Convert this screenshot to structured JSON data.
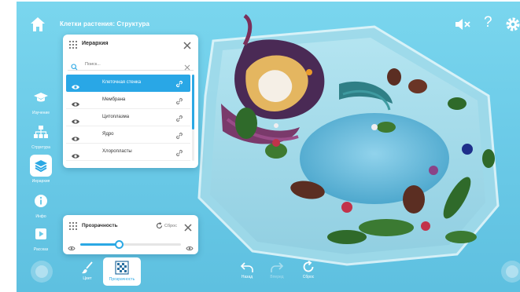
{
  "app": {
    "title": "Клетки растения: Структура"
  },
  "topbar": {
    "help_glyph": "?",
    "icons": [
      "home-icon",
      "mute-icon",
      "help-icon",
      "gear-icon"
    ]
  },
  "sidebar": {
    "items": [
      {
        "label": "Изучение",
        "icon": "graduation-cap-icon",
        "active": false
      },
      {
        "label": "Структура",
        "icon": "hierarchy-tree-icon",
        "active": false
      },
      {
        "label": "Иерархия",
        "icon": "layers-icon",
        "active": true
      },
      {
        "label": "Инфо",
        "icon": "info-icon",
        "active": false
      },
      {
        "label": "Рассказ",
        "icon": "play-icon",
        "active": false
      }
    ]
  },
  "hierarchy_panel": {
    "title": "Иерархия",
    "search_placeholder": "Поиск...",
    "items": [
      {
        "label": "Клеточная стенка",
        "selected": true
      },
      {
        "label": "Мембрана",
        "selected": false
      },
      {
        "label": "Цитоплазма",
        "selected": false
      },
      {
        "label": "Ядро",
        "selected": false
      },
      {
        "label": "Хлоропласты",
        "selected": false
      }
    ]
  },
  "transparency_panel": {
    "title": "Прозрачность",
    "reset_label": "Сброс",
    "value": 0.38
  },
  "bottom_toolbar": {
    "color_label": "Цвет",
    "transparency_label": "Прозрачность",
    "back_label": "Назад",
    "forward_label": "Вперед",
    "reset_label": "Сброс"
  },
  "colors": {
    "background": "#6ccbe8",
    "accent": "#2ba8e4",
    "panel": "#ffffff"
  }
}
